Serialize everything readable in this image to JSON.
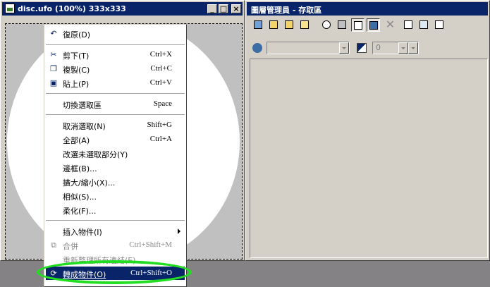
{
  "image_window": {
    "title": "disc.ufo (100%) 333x333",
    "controls": {
      "minimize": "_",
      "maximize": "□",
      "close": "×"
    }
  },
  "context_menu": {
    "items": [
      {
        "label": "復原(D)",
        "shortcut": "",
        "icon": "undo-icon"
      },
      {
        "label": "剪下(T)",
        "shortcut": "Ctrl+X",
        "icon": "scissors-icon"
      },
      {
        "label": "複製(C)",
        "shortcut": "Ctrl+C",
        "icon": "copy-icon"
      },
      {
        "label": "貼上(P)",
        "shortcut": "Ctrl+V",
        "icon": "paste-icon"
      },
      {
        "label": "切換選取區",
        "shortcut": "Space",
        "icon": ""
      },
      {
        "label": "取消選取(N)",
        "shortcut": "Shift+G",
        "icon": ""
      },
      {
        "label": "全部(A)",
        "shortcut": "Ctrl+A",
        "icon": ""
      },
      {
        "label": "改選未選取部分(Y)",
        "shortcut": "",
        "icon": ""
      },
      {
        "label": "邊框(B)...",
        "shortcut": "",
        "icon": ""
      },
      {
        "label": "擴大/縮小(X)...",
        "shortcut": "",
        "icon": ""
      },
      {
        "label": "相似(S)...",
        "shortcut": "",
        "icon": ""
      },
      {
        "label": "柔化(F)...",
        "shortcut": "",
        "icon": ""
      },
      {
        "label": "插入物件(I)",
        "shortcut": "",
        "icon": ""
      },
      {
        "label": "合併",
        "shortcut": "Ctrl+Shift+M",
        "icon": "merge-icon"
      },
      {
        "label": "重新整理所有連結(E)",
        "shortcut": "",
        "icon": ""
      },
      {
        "label": "轉成物件(O)",
        "shortcut": "Ctrl+Shift+O",
        "icon": "convert-object-icon"
      }
    ]
  },
  "library_window": {
    "title": "圖層管理員 - 存取區",
    "spinner_value": "0"
  },
  "colors": {
    "title_bar": "#0a246a",
    "highlight": "#0a246a",
    "annotation": "#22dd22"
  }
}
